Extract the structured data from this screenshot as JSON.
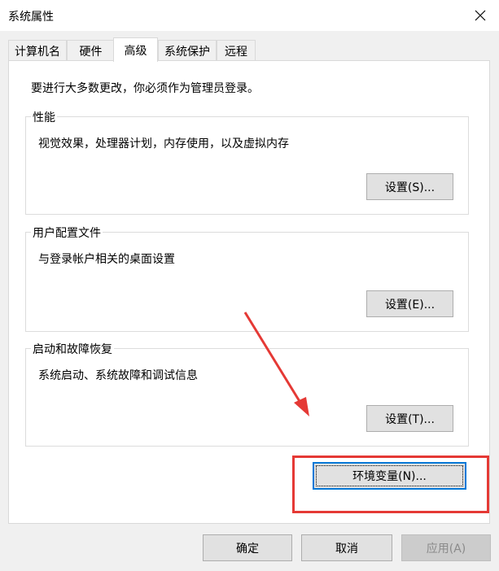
{
  "window": {
    "title": "系统属性"
  },
  "tabs": [
    {
      "label": "计算机名"
    },
    {
      "label": "硬件"
    },
    {
      "label": "高级"
    },
    {
      "label": "系统保护"
    },
    {
      "label": "远程"
    }
  ],
  "active_tab": "高级",
  "notice": "要进行大多数更改，你必须作为管理员登录。",
  "groups": {
    "performance": {
      "title": "性能",
      "desc": "视觉效果，处理器计划，内存使用，以及虚拟内存",
      "button": "设置(S)..."
    },
    "user_profiles": {
      "title": "用户配置文件",
      "desc": "与登录帐户相关的桌面设置",
      "button": "设置(E)..."
    },
    "startup_recovery": {
      "title": "启动和故障恢复",
      "desc": "系统启动、系统故障和调试信息",
      "button": "设置(T)..."
    }
  },
  "env_button": "环境变量(N)...",
  "footer": {
    "ok": "确定",
    "cancel": "取消",
    "apply": "应用(A)"
  },
  "annotation_color": "#e53935",
  "icons": {
    "close": "close-icon"
  }
}
